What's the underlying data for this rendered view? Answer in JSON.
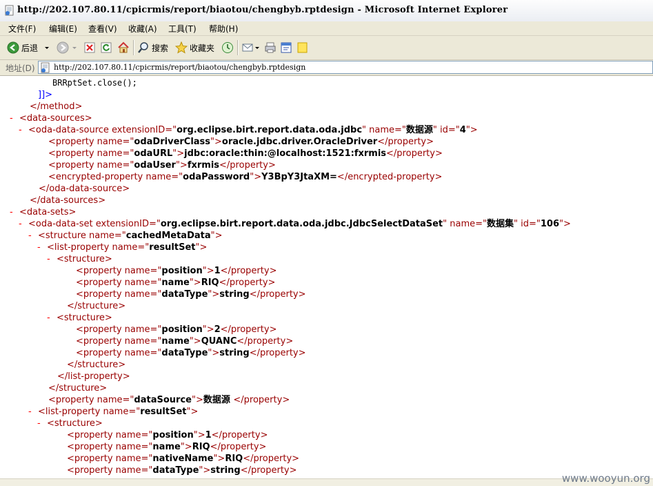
{
  "window": {
    "title": "http://202.107.80.11/cpicrmis/report/biaotou/chengbyb.rptdesign - Microsoft Internet Explorer"
  },
  "menu": [
    "文件(F)",
    "编辑(E)",
    "查看(V)",
    "收藏(A)",
    "工具(T)",
    "帮助(H)"
  ],
  "toolbar": {
    "back": "后退",
    "search": "搜索",
    "favorites": "收藏夹"
  },
  "address": {
    "label": "地址(D)",
    "url": "http://202.107.80.11/cpicrmis/report/biaotou/chengbyb.rptdesign"
  },
  "colors": {
    "tag": "#990000",
    "toggle": "#ff0000",
    "value": "#000000",
    "cdata": "#0000ff",
    "chrome": "#ece9d8"
  },
  "xml_lines": [
    {
      "indent": 76,
      "parts": [
        {
          "t": "BRRptSet.close();",
          "c": "cd"
        }
      ]
    },
    {
      "indent": 55,
      "parts": [
        {
          "t": "]]>",
          "c": "cdb"
        }
      ]
    },
    {
      "indent": 43,
      "parts": [
        {
          "t": "</method>",
          "c": "tg"
        }
      ]
    },
    {
      "indent": 28,
      "toggle": "-",
      "parts": [
        {
          "t": "<data-sources>",
          "c": "tg"
        }
      ]
    },
    {
      "indent": 41,
      "toggle": "-",
      "parts": [
        {
          "t": "<oda-data-source ",
          "c": "tg"
        },
        {
          "t": "extensionID=\"",
          "c": "an"
        },
        {
          "t": "org.eclipse.birt.report.data.oda.jdbc",
          "c": "av"
        },
        {
          "t": "\" name=\"",
          "c": "an"
        },
        {
          "t": "数据源",
          "c": "av"
        },
        {
          "t": "\" id=\"",
          "c": "an"
        },
        {
          "t": "4",
          "c": "av"
        },
        {
          "t": "\">",
          "c": "tg"
        }
      ]
    },
    {
      "indent": 70,
      "parts": [
        {
          "t": "<property name=\"",
          "c": "tg"
        },
        {
          "t": "odaDriverClass",
          "c": "av"
        },
        {
          "t": "\">",
          "c": "tg"
        },
        {
          "t": "oracle.jdbc.driver.OracleDriver",
          "c": "tx"
        },
        {
          "t": "</property>",
          "c": "tg"
        }
      ]
    },
    {
      "indent": 70,
      "parts": [
        {
          "t": "<property name=\"",
          "c": "tg"
        },
        {
          "t": "odaURL",
          "c": "av"
        },
        {
          "t": "\">",
          "c": "tg"
        },
        {
          "t": "jdbc:oracle:thin:@localhost:1521:fxrmis",
          "c": "tx"
        },
        {
          "t": "</property>",
          "c": "tg"
        }
      ]
    },
    {
      "indent": 70,
      "parts": [
        {
          "t": "<property name=\"",
          "c": "tg"
        },
        {
          "t": "odaUser",
          "c": "av"
        },
        {
          "t": "\">",
          "c": "tg"
        },
        {
          "t": "fxrmis",
          "c": "tx"
        },
        {
          "t": "</property>",
          "c": "tg"
        }
      ]
    },
    {
      "indent": 70,
      "parts": [
        {
          "t": "<encrypted-property name=\"",
          "c": "tg"
        },
        {
          "t": "odaPassword",
          "c": "av"
        },
        {
          "t": "\">",
          "c": "tg"
        },
        {
          "t": "Y3BpY3JtaXM=",
          "c": "tx"
        },
        {
          "t": "</encrypted-property>",
          "c": "tg"
        }
      ]
    },
    {
      "indent": 56,
      "parts": [
        {
          "t": "</oda-data-source>",
          "c": "tg"
        }
      ]
    },
    {
      "indent": 43,
      "parts": [
        {
          "t": "</data-sources>",
          "c": "tg"
        }
      ]
    },
    {
      "indent": 28,
      "toggle": "-",
      "parts": [
        {
          "t": "<data-sets>",
          "c": "tg"
        }
      ]
    },
    {
      "indent": 41,
      "toggle": "-",
      "parts": [
        {
          "t": "<oda-data-set ",
          "c": "tg"
        },
        {
          "t": "extensionID=\"",
          "c": "an"
        },
        {
          "t": "org.eclipse.birt.report.data.oda.jdbc.JdbcSelectDataSet",
          "c": "av"
        },
        {
          "t": "\" name=\"",
          "c": "an"
        },
        {
          "t": "数据集",
          "c": "av"
        },
        {
          "t": "\" id=\"",
          "c": "an"
        },
        {
          "t": "106",
          "c": "av"
        },
        {
          "t": "\">",
          "c": "tg"
        }
      ]
    },
    {
      "indent": 55,
      "toggle": "-",
      "parts": [
        {
          "t": "<structure name=\"",
          "c": "tg"
        },
        {
          "t": "cachedMetaData",
          "c": "av"
        },
        {
          "t": "\">",
          "c": "tg"
        }
      ]
    },
    {
      "indent": 68,
      "toggle": "-",
      "parts": [
        {
          "t": "<list-property name=\"",
          "c": "tg"
        },
        {
          "t": "resultSet",
          "c": "av"
        },
        {
          "t": "\">",
          "c": "tg"
        }
      ]
    },
    {
      "indent": 82,
      "toggle": "-",
      "parts": [
        {
          "t": "<structure>",
          "c": "tg"
        }
      ]
    },
    {
      "indent": 110,
      "parts": [
        {
          "t": "<property name=\"",
          "c": "tg"
        },
        {
          "t": "position",
          "c": "av"
        },
        {
          "t": "\">",
          "c": "tg"
        },
        {
          "t": "1",
          "c": "tx"
        },
        {
          "t": "</property>",
          "c": "tg"
        }
      ]
    },
    {
      "indent": 110,
      "parts": [
        {
          "t": "<property name=\"",
          "c": "tg"
        },
        {
          "t": "name",
          "c": "av"
        },
        {
          "t": "\">",
          "c": "tg"
        },
        {
          "t": "RIQ",
          "c": "tx"
        },
        {
          "t": "</property>",
          "c": "tg"
        }
      ]
    },
    {
      "indent": 110,
      "parts": [
        {
          "t": "<property name=\"",
          "c": "tg"
        },
        {
          "t": "dataType",
          "c": "av"
        },
        {
          "t": "\">",
          "c": "tg"
        },
        {
          "t": "string",
          "c": "tx"
        },
        {
          "t": "</property>",
          "c": "tg"
        }
      ]
    },
    {
      "indent": 97,
      "parts": [
        {
          "t": "</structure>",
          "c": "tg"
        }
      ]
    },
    {
      "indent": 82,
      "toggle": "-",
      "parts": [
        {
          "t": "<structure>",
          "c": "tg"
        }
      ]
    },
    {
      "indent": 110,
      "parts": [
        {
          "t": "<property name=\"",
          "c": "tg"
        },
        {
          "t": "position",
          "c": "av"
        },
        {
          "t": "\">",
          "c": "tg"
        },
        {
          "t": "2",
          "c": "tx"
        },
        {
          "t": "</property>",
          "c": "tg"
        }
      ]
    },
    {
      "indent": 110,
      "parts": [
        {
          "t": "<property name=\"",
          "c": "tg"
        },
        {
          "t": "name",
          "c": "av"
        },
        {
          "t": "\">",
          "c": "tg"
        },
        {
          "t": "QUANC",
          "c": "tx"
        },
        {
          "t": "</property>",
          "c": "tg"
        }
      ]
    },
    {
      "indent": 110,
      "parts": [
        {
          "t": "<property name=\"",
          "c": "tg"
        },
        {
          "t": "dataType",
          "c": "av"
        },
        {
          "t": "\">",
          "c": "tg"
        },
        {
          "t": "string",
          "c": "tx"
        },
        {
          "t": "</property>",
          "c": "tg"
        }
      ]
    },
    {
      "indent": 97,
      "parts": [
        {
          "t": "</structure>",
          "c": "tg"
        }
      ]
    },
    {
      "indent": 83,
      "parts": [
        {
          "t": "</list-property>",
          "c": "tg"
        }
      ]
    },
    {
      "indent": 70,
      "parts": [
        {
          "t": "</structure>",
          "c": "tg"
        }
      ]
    },
    {
      "indent": 70,
      "parts": [
        {
          "t": "<property name=\"",
          "c": "tg"
        },
        {
          "t": "dataSource",
          "c": "av"
        },
        {
          "t": "\">",
          "c": "tg"
        },
        {
          "t": "数据源 ",
          "c": "tx"
        },
        {
          "t": "</property>",
          "c": "tg"
        }
      ]
    },
    {
      "indent": 55,
      "toggle": "-",
      "parts": [
        {
          "t": "<list-property name=\"",
          "c": "tg"
        },
        {
          "t": "resultSet",
          "c": "av"
        },
        {
          "t": "\">",
          "c": "tg"
        }
      ]
    },
    {
      "indent": 68,
      "toggle": "-",
      "parts": [
        {
          "t": "<structure>",
          "c": "tg"
        }
      ]
    },
    {
      "indent": 97,
      "parts": [
        {
          "t": "<property name=\"",
          "c": "tg"
        },
        {
          "t": "position",
          "c": "av"
        },
        {
          "t": "\">",
          "c": "tg"
        },
        {
          "t": "1",
          "c": "tx"
        },
        {
          "t": "</property>",
          "c": "tg"
        }
      ]
    },
    {
      "indent": 97,
      "parts": [
        {
          "t": "<property name=\"",
          "c": "tg"
        },
        {
          "t": "name",
          "c": "av"
        },
        {
          "t": "\">",
          "c": "tg"
        },
        {
          "t": "RIQ",
          "c": "tx"
        },
        {
          "t": "</property>",
          "c": "tg"
        }
      ]
    },
    {
      "indent": 97,
      "parts": [
        {
          "t": "<property name=\"",
          "c": "tg"
        },
        {
          "t": "nativeName",
          "c": "av"
        },
        {
          "t": "\">",
          "c": "tg"
        },
        {
          "t": "RIQ",
          "c": "tx"
        },
        {
          "t": "</property>",
          "c": "tg"
        }
      ]
    },
    {
      "indent": 97,
      "parts": [
        {
          "t": "<property name=\"",
          "c": "tg"
        },
        {
          "t": "dataType",
          "c": "av"
        },
        {
          "t": "\">",
          "c": "tg"
        },
        {
          "t": "string",
          "c": "tx"
        },
        {
          "t": "</property>",
          "c": "tg"
        }
      ]
    }
  ],
  "watermark": "www.wooyun.org"
}
